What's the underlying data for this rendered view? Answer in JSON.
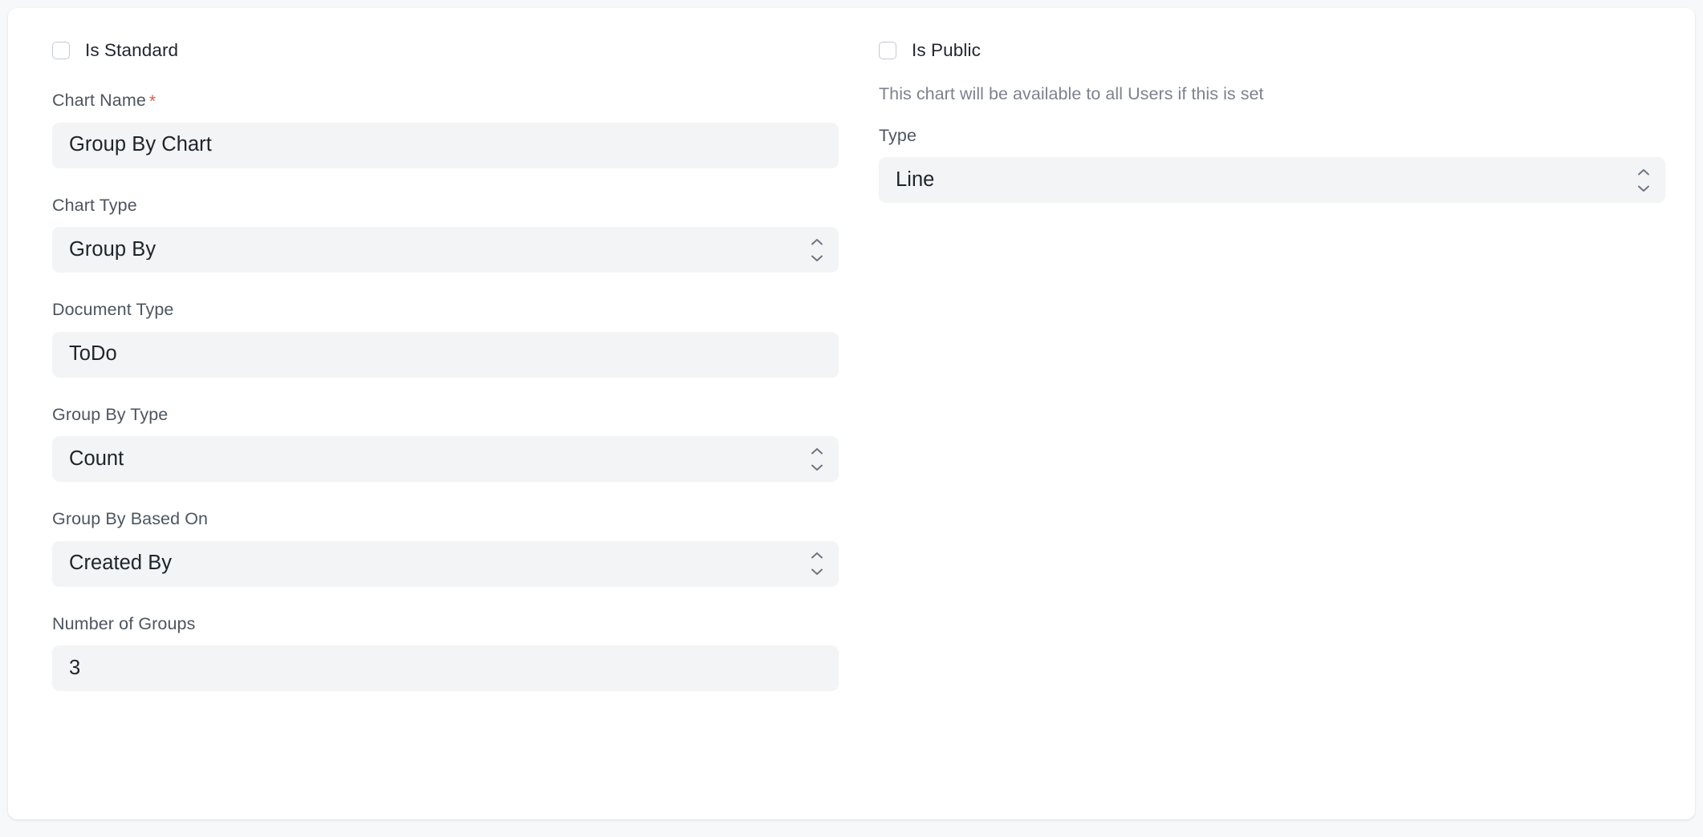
{
  "form": {
    "left_column": {
      "checkbox": {
        "label": "Is Standard",
        "checked": false
      },
      "fields": [
        {
          "label": "Chart Name",
          "required": true,
          "value": "Group By Chart",
          "control": "text"
        },
        {
          "label": "Chart Type",
          "required": false,
          "value": "Group By",
          "control": "select"
        },
        {
          "label": "Document Type",
          "required": false,
          "value": "ToDo",
          "control": "link"
        },
        {
          "label": "Group By Type",
          "required": false,
          "value": "Count",
          "control": "select"
        },
        {
          "label": "Group By Based On",
          "required": false,
          "value": "Created By",
          "control": "select"
        },
        {
          "label": "Number of Groups",
          "required": false,
          "value": "3",
          "control": "number"
        }
      ]
    },
    "right_column": {
      "checkbox": {
        "label": "Is Public",
        "checked": false
      },
      "help_text": "This chart will be available to all Users if this is set",
      "fields": [
        {
          "label": "Type",
          "required": false,
          "value": "Line",
          "control": "select"
        }
      ]
    }
  },
  "colors": {
    "page_background": "#f7f8f9",
    "card_background": "#ffffff",
    "field_background": "#f2f4f5",
    "label_text": "#4d555f",
    "value_text": "#1d242c",
    "help_text": "#7c838d",
    "required_asterisk": "#e2574c",
    "checkbox_border": "#c3cad4",
    "chevron": "#6b7480"
  },
  "icons": {
    "select_chevrons": "chevron-up-down-icon",
    "checkbox": "checkbox-unchecked-icon"
  }
}
